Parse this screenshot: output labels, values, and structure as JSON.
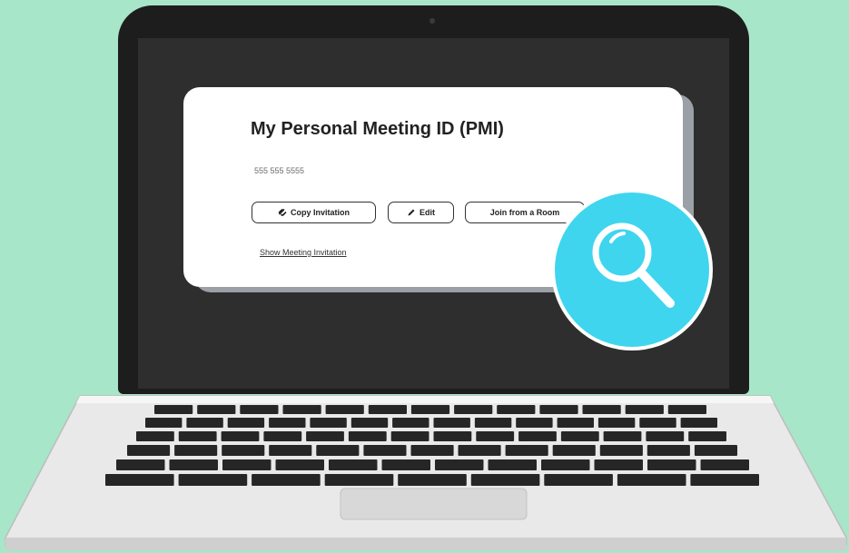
{
  "card": {
    "title": "My Personal Meeting ID (PMI)",
    "pmi_number": "555 555 5555",
    "buttons": {
      "copy_label": "Copy Invitation",
      "edit_label": "Edit",
      "join_label": "Join from a Room"
    },
    "show_link": "Show Meeting Invitation"
  },
  "icons": {
    "copy": "link-icon",
    "edit": "pencil-icon",
    "badge": "magnifying-glass-icon"
  },
  "colors": {
    "background": "#a8e6c9",
    "badge": "#3fd5ee",
    "laptop_lid": "#1d1d1d",
    "screen": "#2e2e2e",
    "card": "#ffffff"
  }
}
